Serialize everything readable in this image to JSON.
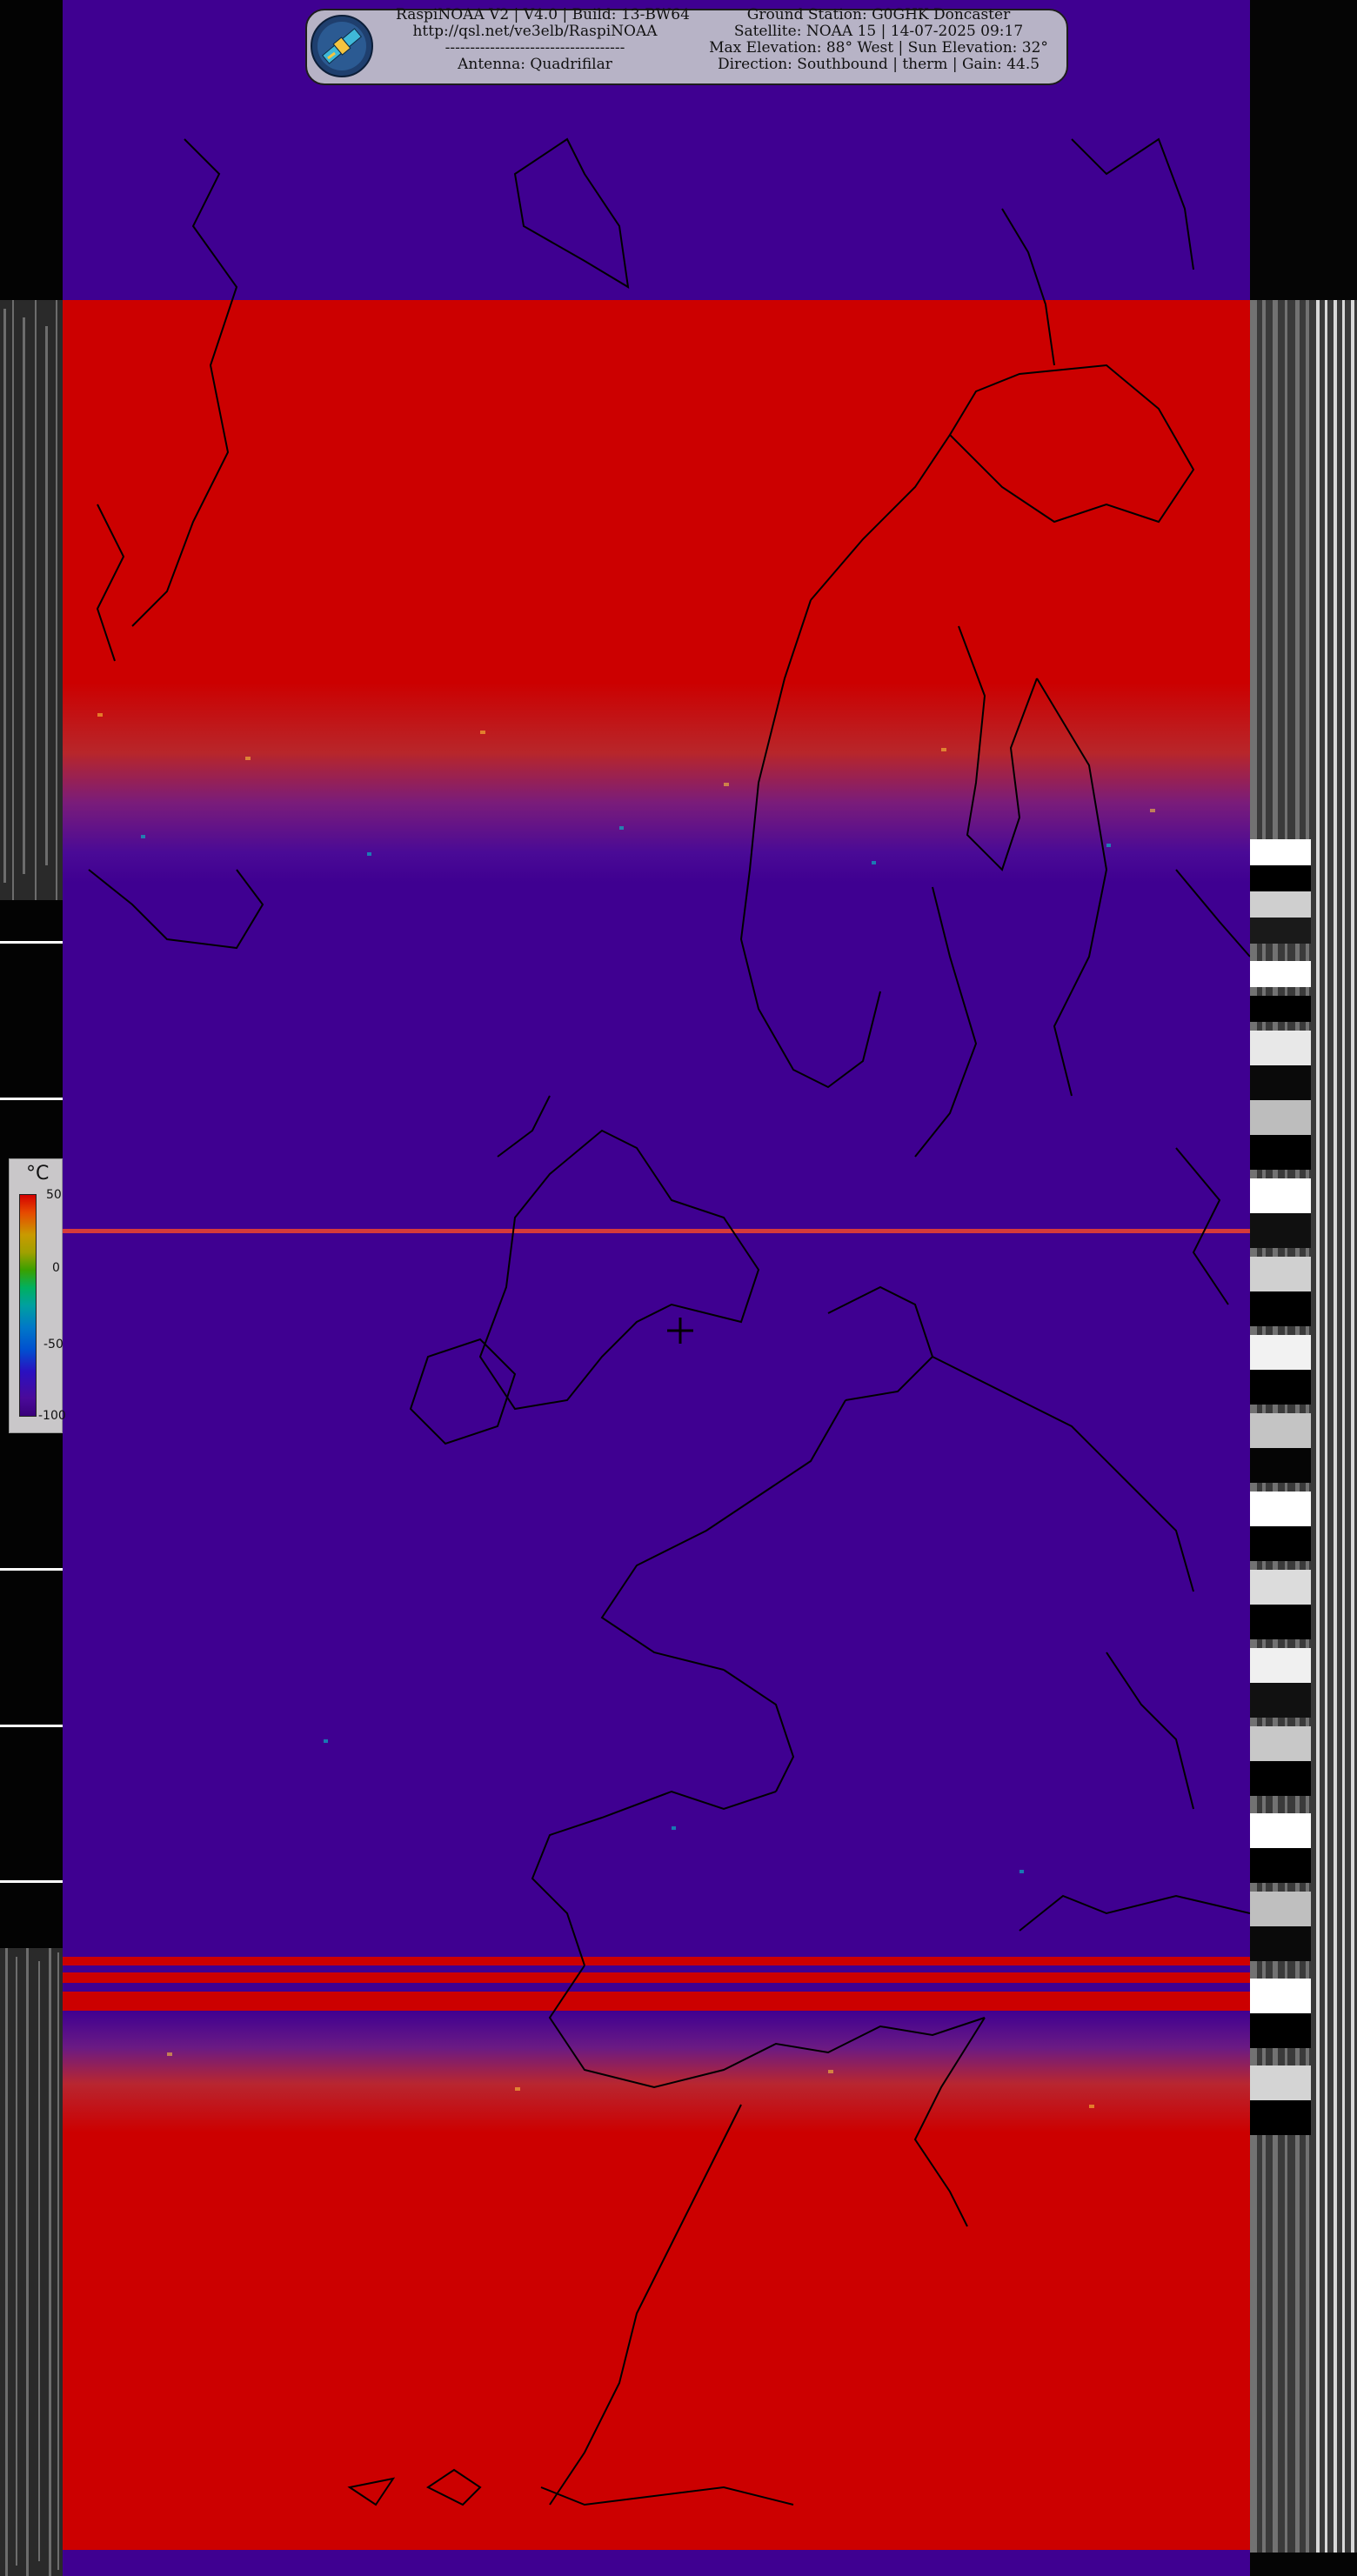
{
  "header": {
    "left_lines": [
      "RaspiNOAA V2 | V4.0 | Build: 13-BW64",
      "http://qsl.net/ve3elb/RaspiNOAA",
      "------------------------------------",
      "Antenna: Quadrifilar"
    ],
    "right_lines": [
      "Ground Station: G0GHK Doncaster",
      "Satellite: NOAA 15 | 14-07-2025 09:17",
      "Max Elevation: 88° West | Sun Elevation: 32°",
      "Direction: Southbound | therm | Gain: 44.5"
    ]
  },
  "legend": {
    "unit": "°C",
    "ticks": [
      "50",
      "0",
      "-50",
      "-100"
    ]
  },
  "colors": {
    "land_hot": "#cc0000",
    "cold_water": "#3f0091",
    "coastline": "#000000",
    "header_bg": "#b7b3c6"
  }
}
